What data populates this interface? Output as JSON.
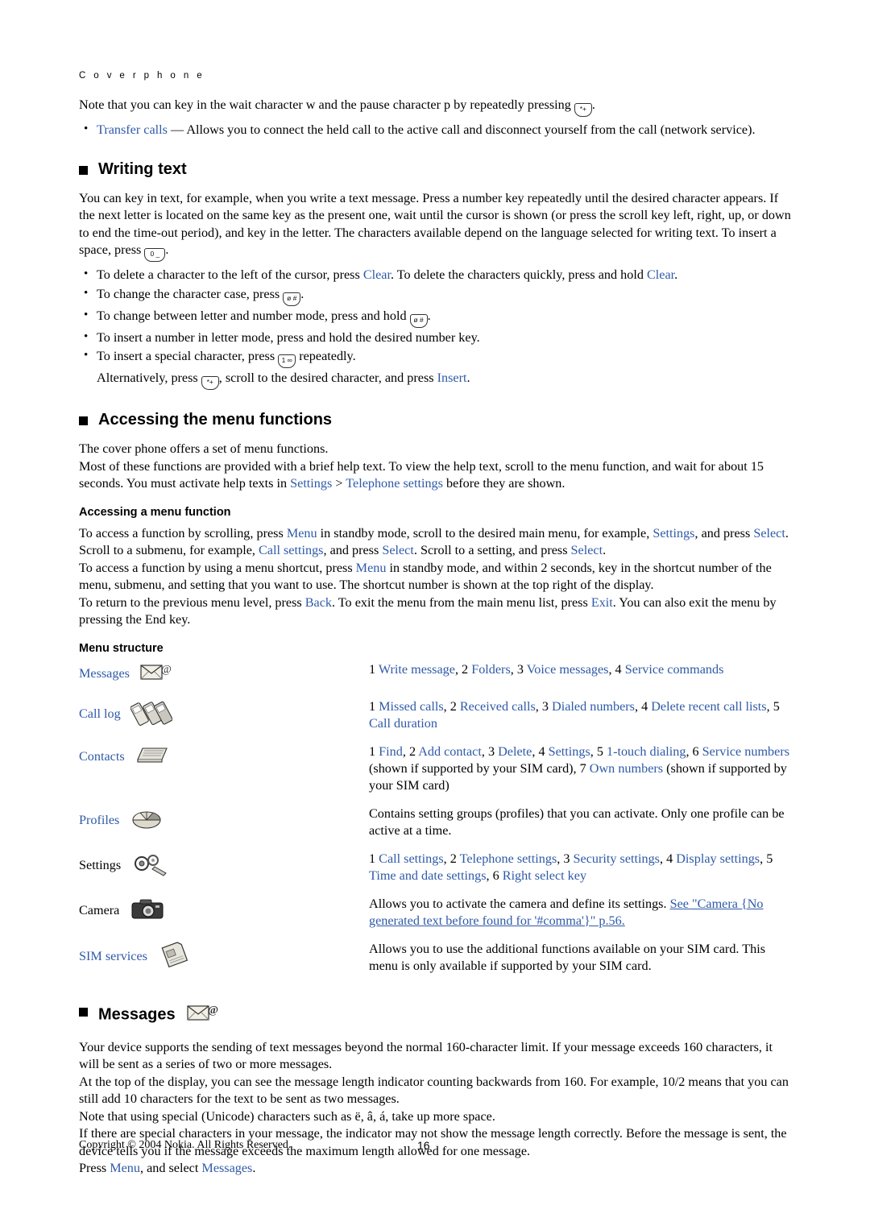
{
  "header": {
    "running_head": "C o v e r   p h o n e"
  },
  "intro": {
    "note_1": "Note that you can key in the wait character w and the pause character p by repeatedly pressing",
    "note_1_key": "*+",
    "note_1_end": ".",
    "bullet_transfer_label": "Transfer calls",
    "bullet_transfer_text": "— Allows you to connect the held call to the active call and disconnect yourself from the call (network service)."
  },
  "writing_text": {
    "heading": "Writing text",
    "p1_a": "You can key in text, for example, when you write a text message. Press a number key repeatedly until the desired character appears. If the next letter is located on the same key as the present one, wait until the cursor is shown (or press the scroll key left, right, up, or down to end the time-out period), and key in the letter. The characters available depend on the language selected for writing text. To insert a space, press",
    "p1_key": "0 _",
    "p1_b": ".",
    "bullets": [
      {
        "a": "To delete a character to the left of the cursor, press",
        "link1": "Clear",
        "b": ". To delete the characters quickly, press and hold",
        "link2": "Clear",
        "c": "."
      },
      {
        "a": "To change the character case, press",
        "key": "ø #",
        "b": "."
      },
      {
        "a": "To change between letter and number mode, press and hold",
        "key": "ø #",
        "b": "."
      },
      {
        "a": "To insert a number in letter mode, press and hold the desired number key.",
        "key": "",
        "b": ""
      },
      {
        "a": "To insert a special character, press",
        "key": "1 ∞",
        "b": "repeatedly."
      }
    ],
    "alt_a": "Alternatively, press",
    "alt_key": "*+",
    "alt_b": ", scroll to the desired character, and press",
    "alt_link": "Insert",
    "alt_c": "."
  },
  "accessing": {
    "heading": "Accessing the menu functions",
    "p1": "The cover phone offers a set of menu functions.",
    "p2_a": "Most of these functions are provided with a brief help text. To view the help text, scroll to the menu function, and wait for about 15 seconds. You must activate help texts in",
    "p2_link1": "Settings",
    "p2_gt": ">",
    "p2_link2": "Telephone settings",
    "p2_b": "before they are shown.",
    "sub1": "Accessing a menu function",
    "p3_a": "To access a function by scrolling, press",
    "p3_link1": "Menu",
    "p3_b": "in standby mode, scroll to the desired main menu, for example,",
    "p3_link2": "Settings",
    "p3_c": ", and press",
    "p3_link3": "Select",
    "p3_d": ". Scroll to a submenu, for example,",
    "p3_link4": "Call settings",
    "p3_e": ", and press",
    "p3_link5": "Select",
    "p3_f": ". Scroll to a setting, and press",
    "p3_link6": "Select",
    "p3_g": ".",
    "p4_a": "To access a function by using a menu shortcut, press",
    "p4_link1": "Menu",
    "p4_b": "in standby mode, and within 2 seconds, key in the shortcut number of the menu, submenu, and setting that you want to use. The shortcut number is shown at the top right of the display.",
    "p5_a": "To return to the previous menu level, press",
    "p5_link1": "Back",
    "p5_b": ". To exit the menu from the main menu list, press",
    "p5_link2": "Exit",
    "p5_c": ". You can also exit the menu by pressing the End key.",
    "sub2": "Menu structure"
  },
  "menu_structure": {
    "rows": [
      {
        "name": "Messages",
        "icon": "messages-icon",
        "desc_segments": [
          {
            "t": "1 ",
            "c": "black"
          },
          {
            "t": "Write message",
            "c": "blue"
          },
          {
            "t": ", 2 ",
            "c": "black"
          },
          {
            "t": "Folders",
            "c": "blue"
          },
          {
            "t": ", 3 ",
            "c": "black"
          },
          {
            "t": "Voice messages",
            "c": "blue"
          },
          {
            "t": ", 4 ",
            "c": "black"
          },
          {
            "t": "Service commands",
            "c": "blue"
          }
        ]
      },
      {
        "name": "Call log",
        "icon": "call-log-icon",
        "desc_segments": [
          {
            "t": "1 ",
            "c": "black"
          },
          {
            "t": "Missed calls",
            "c": "blue"
          },
          {
            "t": ", 2 ",
            "c": "black"
          },
          {
            "t": "Received calls",
            "c": "blue"
          },
          {
            "t": ", 3 ",
            "c": "black"
          },
          {
            "t": "Dialed numbers",
            "c": "blue"
          },
          {
            "t": ", 4 ",
            "c": "black"
          },
          {
            "t": "Delete recent call lists",
            "c": "blue"
          },
          {
            "t": ", 5 ",
            "c": "black"
          },
          {
            "t": "Call duration",
            "c": "blue"
          }
        ]
      },
      {
        "name": "Contacts",
        "icon": "contacts-icon",
        "desc_segments": [
          {
            "t": "1 ",
            "c": "black"
          },
          {
            "t": "Find",
            "c": "blue"
          },
          {
            "t": ", 2 ",
            "c": "black"
          },
          {
            "t": "Add contact",
            "c": "blue"
          },
          {
            "t": ", 3 ",
            "c": "black"
          },
          {
            "t": "Delete",
            "c": "blue"
          },
          {
            "t": ", 4 ",
            "c": "black"
          },
          {
            "t": "Settings",
            "c": "blue"
          },
          {
            "t": ", 5 ",
            "c": "black"
          },
          {
            "t": "1-touch dialing",
            "c": "blue"
          },
          {
            "t": ", 6 ",
            "c": "black"
          },
          {
            "t": "Service numbers",
            "c": "blue"
          },
          {
            "t": " (shown if supported by your SIM card), 7 ",
            "c": "black"
          },
          {
            "t": "Own numbers",
            "c": "blue"
          },
          {
            "t": " (shown if supported by your SIM card)",
            "c": "black"
          }
        ]
      },
      {
        "name": "Profiles",
        "icon": "profiles-icon",
        "desc_segments": [
          {
            "t": "Contains setting groups (profiles) that you can activate. Only one profile can be active at a time.",
            "c": "black"
          }
        ]
      },
      {
        "name": "Settings",
        "icon": "settings-icon",
        "desc_segments": [
          {
            "t": "1 ",
            "c": "black"
          },
          {
            "t": "Call settings",
            "c": "blue"
          },
          {
            "t": ", 2 ",
            "c": "black"
          },
          {
            "t": "Telephone settings",
            "c": "blue"
          },
          {
            "t": ", 3 ",
            "c": "black"
          },
          {
            "t": "Security settings",
            "c": "blue"
          },
          {
            "t": ", 4 ",
            "c": "black"
          },
          {
            "t": "Display settings",
            "c": "blue"
          },
          {
            "t": ", 5 ",
            "c": "black"
          },
          {
            "t": "Time and date settings",
            "c": "blue"
          },
          {
            "t": ", 6 ",
            "c": "black"
          },
          {
            "t": "Right select key",
            "c": "blue"
          }
        ]
      },
      {
        "name": "Camera",
        "icon": "camera-icon",
        "desc_segments": [
          {
            "t": "Allows you to activate the camera and define its settings. ",
            "c": "black"
          },
          {
            "t": "See \"Camera {No generated text before found for '#comma'}\" p.56.",
            "c": "blue-underline"
          }
        ]
      },
      {
        "name": "SIM services",
        "icon": "sim-services-icon",
        "desc_segments": [
          {
            "t": "Allows you to use the additional functions available on your SIM card. This menu is only available if supported by your SIM card.",
            "c": "black"
          }
        ]
      }
    ]
  },
  "messages_section": {
    "heading": "Messages",
    "icon": "messages-icon",
    "p1": "Your device supports the sending of text messages beyond the normal 160-character limit. If your message exceeds 160 characters, it will be sent as a series of two or more messages.",
    "p2": "At the top of the display, you can see the message length indicator counting backwards from 160. For example, 10/2 means that you can still add 10 characters for the text to be sent as two messages.",
    "p3": "Note that using special (Unicode) characters such as ë, â, á, take up more space.",
    "p4": "If there are special characters in your message, the indicator may not show the message length correctly. Before the message is sent, the device tells you if the message exceeds the maximum length allowed for one message.",
    "p5_a": "Press",
    "p5_link1": "Menu",
    "p5_b": ", and select",
    "p5_link2": "Messages",
    "p5_c": "."
  },
  "footer": {
    "copyright": "Copyright © 2004 Nokia. All Rights Reserved.",
    "page_number": "16"
  },
  "colors": {
    "link_blue": "#2f5aa8",
    "text_black": "#000000"
  }
}
